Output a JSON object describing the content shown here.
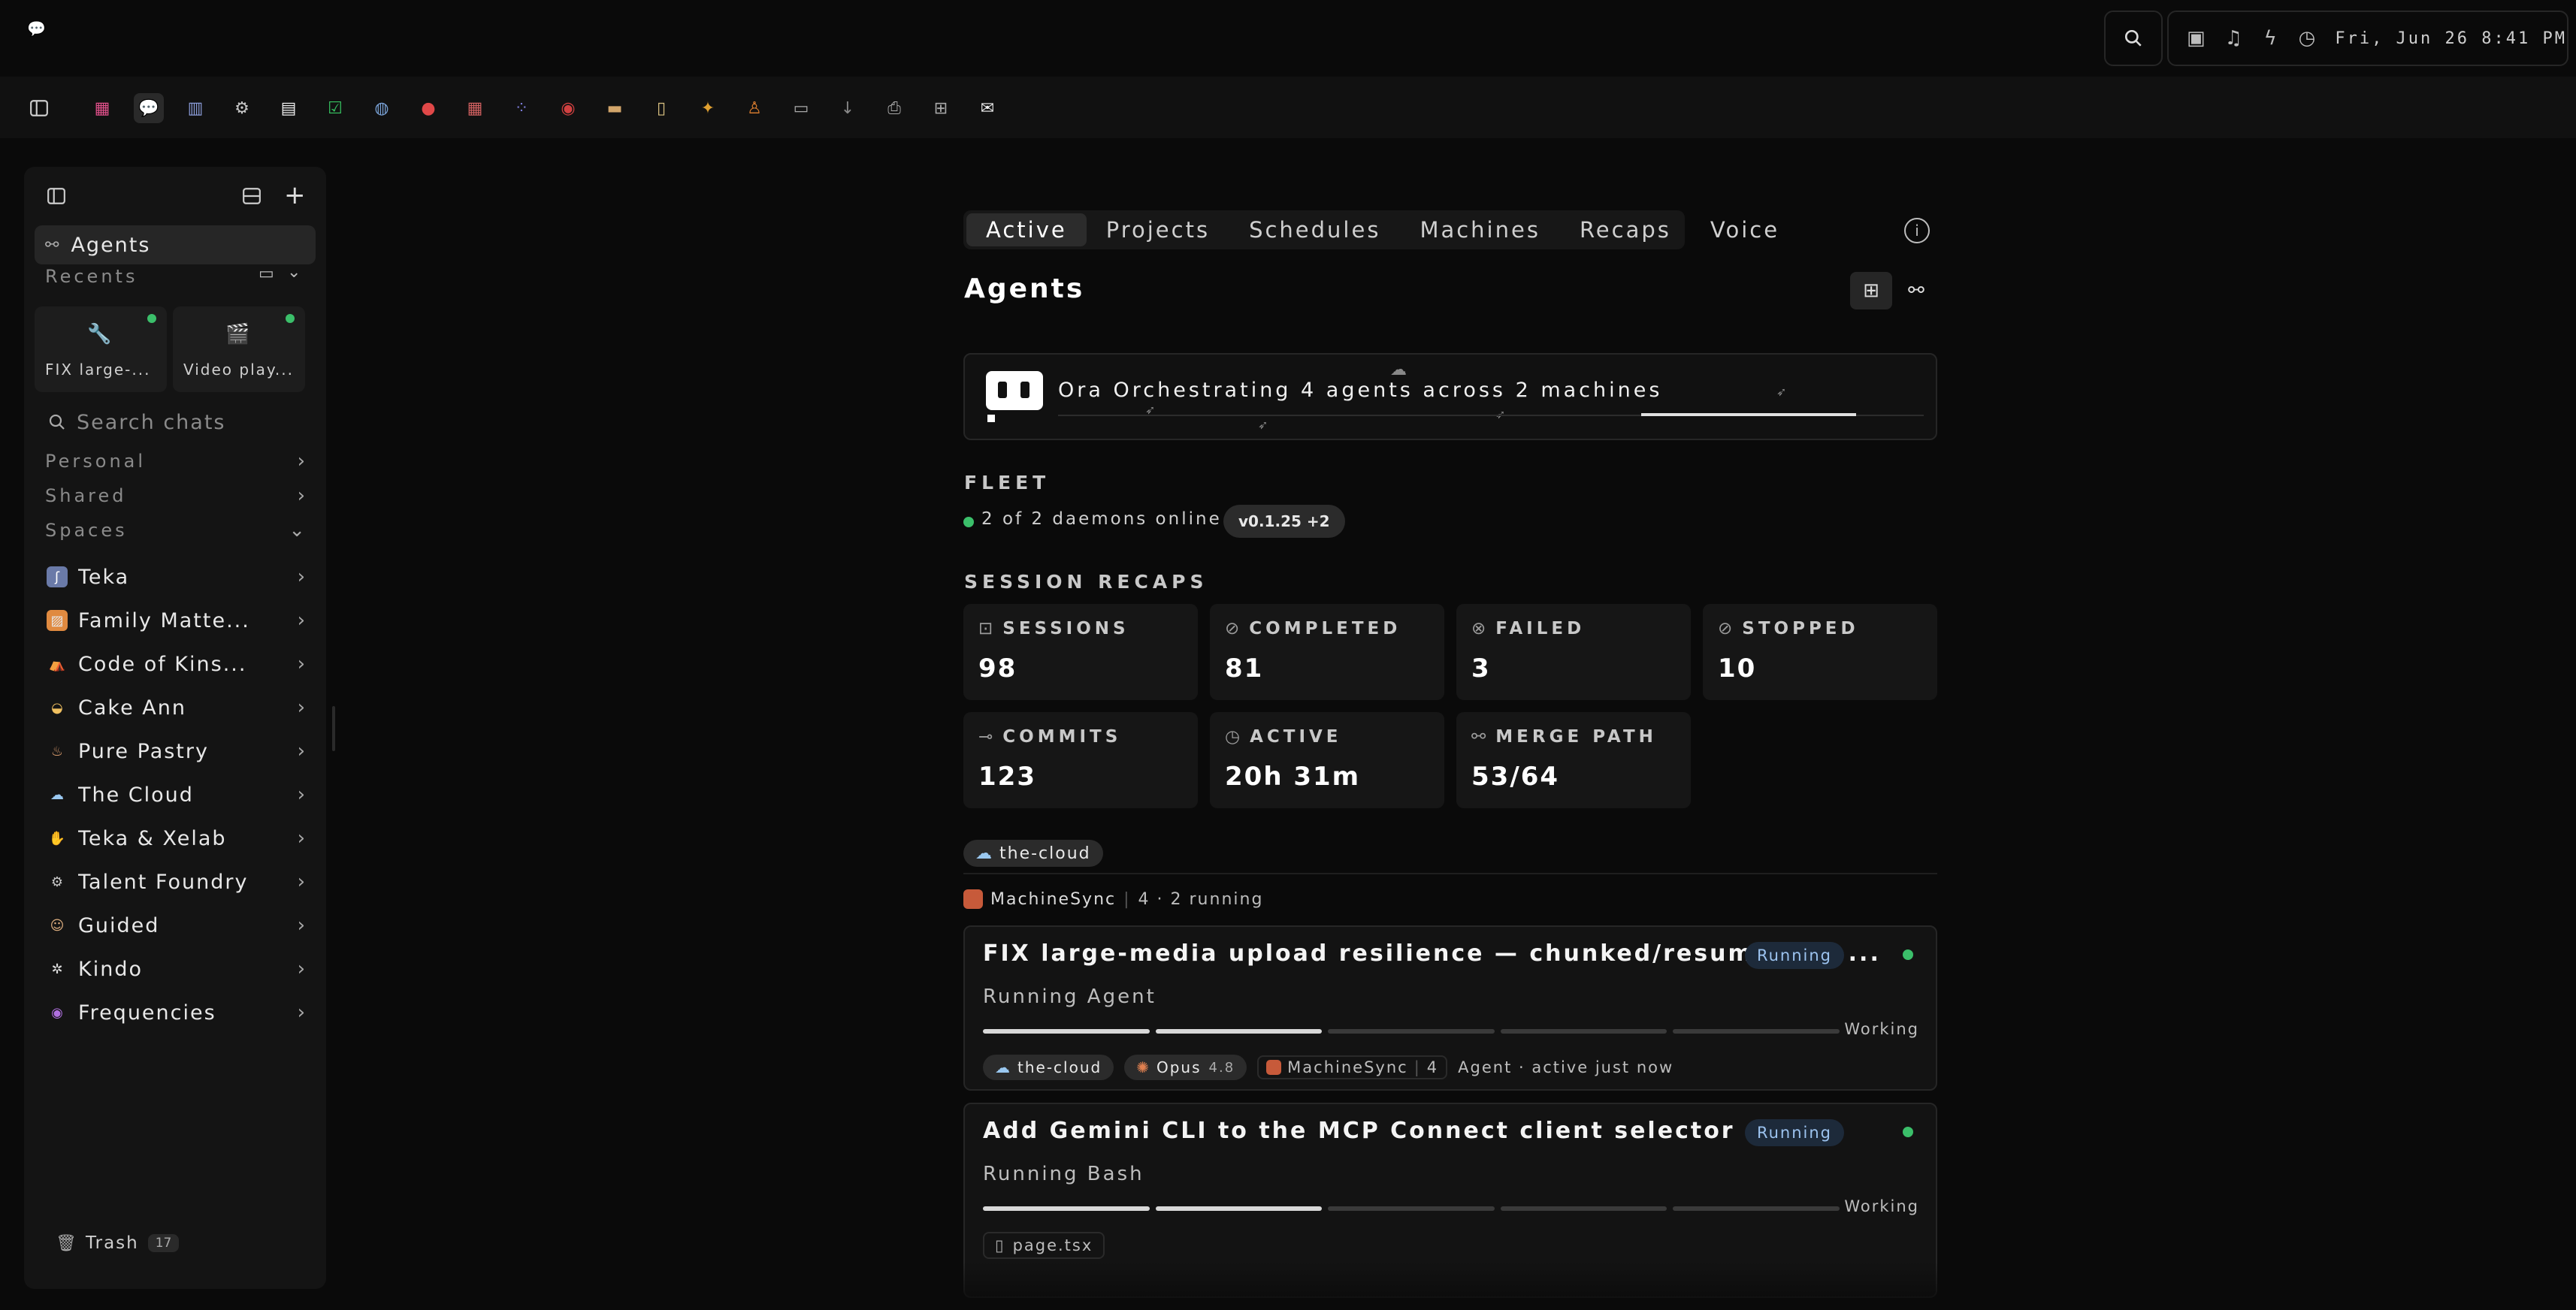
{
  "topbar": {
    "clock": "Fri, Jun 26   8:41 PM"
  },
  "dock": {
    "apps": [
      "sidebar-toggle-icon",
      "grid-icon",
      "chat-icon",
      "chart-icon",
      "gear-icon",
      "document-icon",
      "check-icon",
      "globe-icon",
      "apple-icon",
      "calendar-icon",
      "dots-icon",
      "record-icon",
      "folder-icon",
      "clipboard-icon",
      "butterfly-icon",
      "figure-icon",
      "terminal-icon",
      "download-icon",
      "printer-icon",
      "cart-icon",
      "mail-icon"
    ]
  },
  "sidebar": {
    "agents_label": "Agents",
    "recents_label": "Recents",
    "recents": [
      {
        "label": "FIX large-...",
        "icon": "wrench-icon"
      },
      {
        "label": "Video play...",
        "icon": "clapper-icon"
      }
    ],
    "search_placeholder": "Search chats",
    "sections": [
      "Personal",
      "Shared",
      "Spaces"
    ],
    "spaces": [
      {
        "label": "Teka",
        "icon": "teka-icon"
      },
      {
        "label": "Family Matte...",
        "icon": "picture-icon"
      },
      {
        "label": "Code of Kins...",
        "icon": "family-icon"
      },
      {
        "label": "Cake Ann",
        "icon": "cake-icon"
      },
      {
        "label": "Pure Pastry",
        "icon": "pastry-icon"
      },
      {
        "label": "The Cloud",
        "icon": "cloud-icon"
      },
      {
        "label": "Teka & Xelab",
        "icon": "hand-icon"
      },
      {
        "label": "Talent Foundry",
        "icon": "cog-icon"
      },
      {
        "label": "Guided",
        "icon": "person-icon"
      },
      {
        "label": "Kindo",
        "icon": "asterisk-icon"
      },
      {
        "label": "Frequencies",
        "icon": "orb-icon"
      }
    ],
    "trash_label": "Trash",
    "trash_count": "17"
  },
  "main": {
    "tabs": [
      "Active",
      "Projects",
      "Schedules",
      "Machines",
      "Recaps",
      "Voice"
    ],
    "active_tab": "Active",
    "title": "Agents",
    "ora_text": "Ora Orchestrating 4 agents across 2 machines",
    "fleet_heading": "FLEET",
    "fleet_status": "2 of 2 daemons online",
    "fleet_version": "v0.1.25 +2",
    "recaps_heading": "SESSION RECAPS",
    "stats": [
      {
        "label": "SESSIONS",
        "value": "98",
        "icon": "box-icon"
      },
      {
        "label": "COMPLETED",
        "value": "81",
        "icon": "check-circle-icon"
      },
      {
        "label": "FAILED",
        "value": "3",
        "icon": "x-circle-icon"
      },
      {
        "label": "STOPPED",
        "value": "10",
        "icon": "stop-circle-icon"
      },
      {
        "label": "COMMITS",
        "value": "123",
        "icon": "commit-icon"
      },
      {
        "label": "ACTIVE",
        "value": "20h 31m",
        "icon": "clock-icon"
      },
      {
        "label": "MERGE PATH",
        "value": "53/64",
        "icon": "merge-icon"
      }
    ],
    "workspace_chip": "the-cloud",
    "machine_name": "MachineSync",
    "machine_meta": "4 · 2 running",
    "agents": [
      {
        "title": "FIX large-media upload resilience — chunked/resumable +...",
        "badge": "Running",
        "subtitle": "Running Agent",
        "progress_segments_on": 2,
        "progress_segments_total": 5,
        "state": "Working",
        "chip_workspace": "the-cloud",
        "chip_model": "Opus",
        "chip_model_version": "4.8",
        "chip_machine": "MachineSync",
        "chip_machine_count": "4",
        "activity": "Agent · active just now"
      },
      {
        "title": "Add Gemini CLI to the MCP Connect client selector",
        "badge": "Running",
        "subtitle": "Running Bash",
        "progress_segments_on": 2,
        "progress_segments_total": 5,
        "state": "Working",
        "file_chip": "page.tsx"
      }
    ]
  }
}
